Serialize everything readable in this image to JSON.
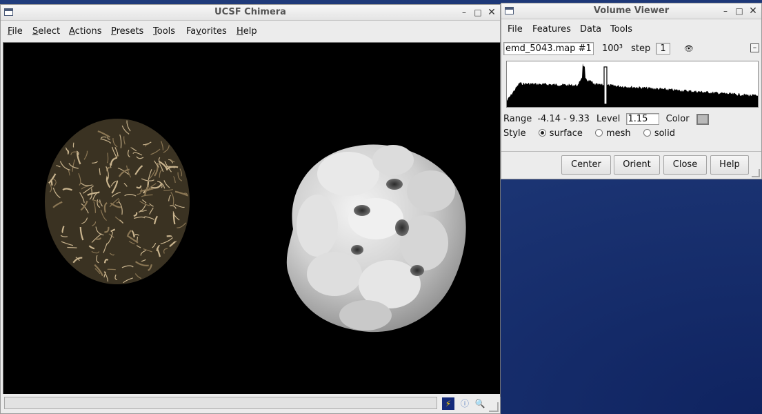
{
  "chimera": {
    "title": "UCSF Chimera",
    "menu": [
      {
        "ul": "F",
        "rest": "ile"
      },
      {
        "ul": "S",
        "rest": "elect"
      },
      {
        "ul": "A",
        "rest": "ctions"
      },
      {
        "ul": "P",
        "rest": "resets"
      },
      {
        "ul": "T",
        "rest": "ools"
      },
      {
        "pre": "Fa",
        "ul": "v",
        "rest": "orites"
      },
      {
        "ul": "H",
        "rest": "elp"
      }
    ],
    "status_text": "",
    "status_icons": [
      "lightning-icon",
      "info-icon",
      "magnifier-icon"
    ]
  },
  "volume_viewer": {
    "title": "Volume Viewer",
    "menu": [
      "File",
      "Features",
      "Data",
      "Tools"
    ],
    "map_name": "emd_5043.map #1",
    "size": "100³",
    "step_label": "step",
    "step_value": "1",
    "range_label": "Range",
    "range_value": "-4.14 - 9.33",
    "level_label": "Level",
    "level_value": "1.15",
    "color_label": "Color",
    "style_label": "Style",
    "styles": [
      {
        "label": "surface",
        "selected": true
      },
      {
        "label": "mesh",
        "selected": false
      },
      {
        "label": "solid",
        "selected": false
      }
    ],
    "buttons": [
      "Center",
      "Orient",
      "Close",
      "Help"
    ],
    "surface_color": "#b9b9b9",
    "eye_icon": "eye-icon"
  },
  "colors": {
    "protein_ribbon": "#c9b48e",
    "density_surface": "#d8d8d8",
    "desktop": "#1b3473"
  }
}
